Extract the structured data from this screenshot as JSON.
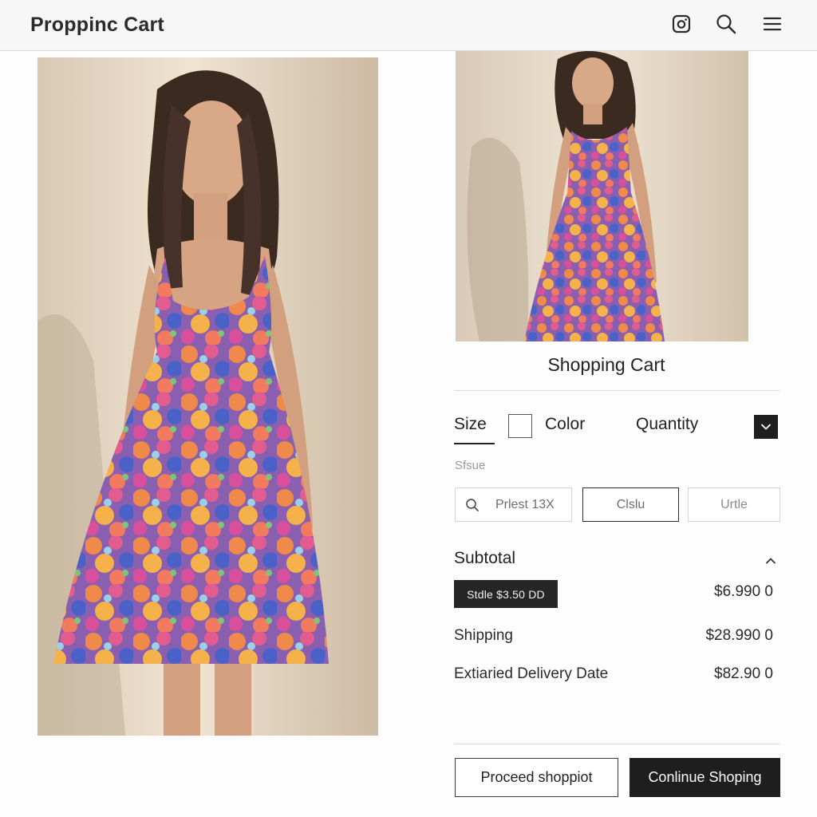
{
  "header": {
    "title": "Proppinc Cart",
    "icons": [
      "camera-icon",
      "search-icon",
      "menu-icon"
    ]
  },
  "product": {
    "main_image": "floral-dress-photo",
    "side_image": "floral-dress-photo-full"
  },
  "cart": {
    "heading": "Shopping Cart",
    "options": {
      "size_label": "Size",
      "color_label": "Color",
      "quantity_label": "Quantity",
      "size_caption": "Sfsue",
      "search_value": "Prlest 13X",
      "color_value": "Clslu",
      "unit_value": "Urtle"
    },
    "summary": {
      "subtotal_label": "Subtotal",
      "store_badge": "Stdle $3.50 DD",
      "subtotal_value": "$6.990 0",
      "shipping_label": "Shipping",
      "shipping_value": "$28.990 0",
      "delivery_label": "Extiaried Delivery Date",
      "delivery_value": "$82.90 0"
    },
    "buttons": {
      "proceed": "Proceed shoppiot",
      "continue": "Conlinue Shoping"
    }
  },
  "colors": {
    "accent_dark": "#1e1e1e",
    "header_bg": "#f7f7f7",
    "divider": "#d7d7d7"
  }
}
